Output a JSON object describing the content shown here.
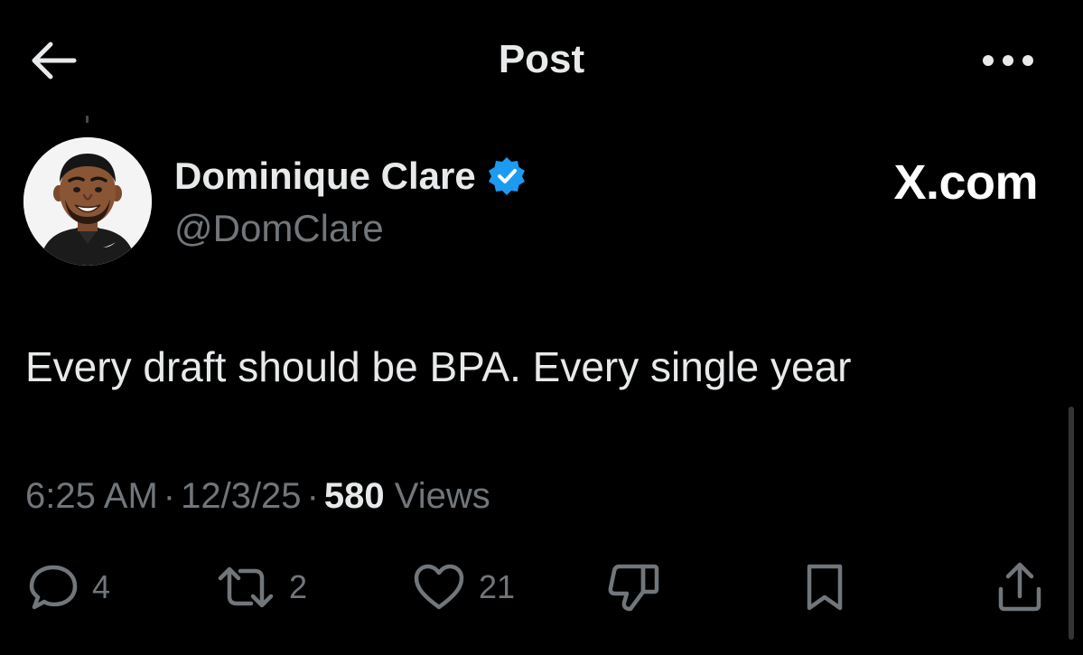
{
  "header": {
    "title": "Post",
    "back_icon": "arrow-left-icon",
    "more_icon": "more-horizontal-icon"
  },
  "author": {
    "name": "Dominique Clare",
    "handle": "@DomClare",
    "verified": true,
    "verified_color": "#1d9bf0"
  },
  "watermark": "X.com",
  "post": {
    "text": "Every draft should be BPA. Every single year",
    "time": "6:25 AM",
    "date": "12/3/25",
    "separator": "·",
    "views_count": "580",
    "views_label": "Views"
  },
  "actions": {
    "reply": {
      "icon": "reply-icon",
      "count": "4"
    },
    "repost": {
      "icon": "repost-icon",
      "count": "2"
    },
    "like": {
      "icon": "heart-icon",
      "count": "21"
    },
    "dislike": {
      "icon": "thumbs-down-icon"
    },
    "bookmark": {
      "icon": "bookmark-icon"
    },
    "share": {
      "icon": "share-icon"
    }
  },
  "colors": {
    "background": "#000000",
    "primary_text": "#e7e9ea",
    "secondary_text": "#71767b",
    "accent": "#1d9bf0"
  }
}
